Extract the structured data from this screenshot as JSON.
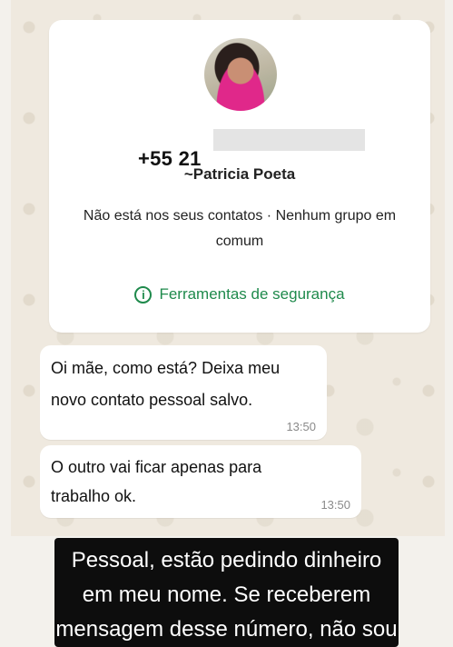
{
  "contact": {
    "phone": "+55 21",
    "alias": "~Patricia Poeta",
    "status": "Não está nos seus contatos · Nenhum grupo em comum",
    "security_label": "Ferramentas de segurança",
    "security_icon": "info-icon"
  },
  "messages": [
    {
      "text": "Oi mãe, como está? Deixa meu novo contato pessoal salvo.",
      "time": "13:50"
    },
    {
      "text": "O outro vai ficar apenas para trabalho ok.",
      "time": "13:50"
    }
  ],
  "caption": {
    "line1": "Pessoal, estão pedindo dinheiro",
    "line2": "em meu nome. Se receberem",
    "line3": "mensagem desse número, não sou"
  },
  "colors": {
    "accent": "#1f8a4c",
    "bubble": "#ffffff",
    "caption_bg": "#0d0d0d"
  }
}
